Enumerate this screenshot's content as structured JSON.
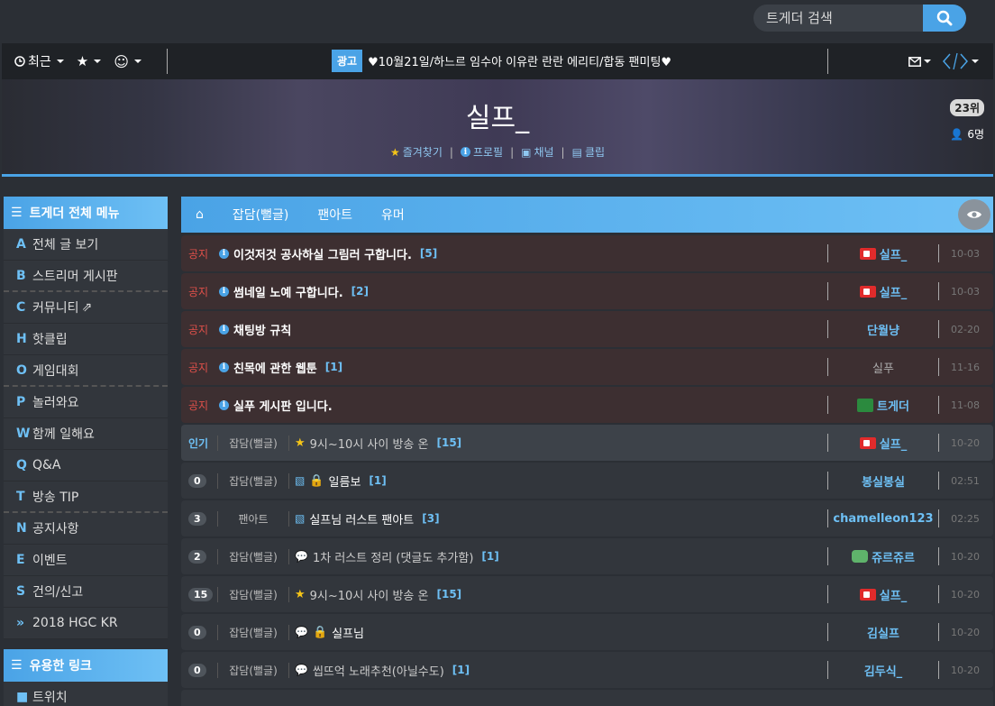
{
  "search": {
    "placeholder": "트게더 검색"
  },
  "nav": {
    "recent": "최근",
    "ad_tag": "광고",
    "ad_text": "♥10월21일/하느르 임수아 이유란 란란 에리티/합동 팬미팅♥"
  },
  "banner": {
    "title": "실프_",
    "links": [
      "즐겨찾기",
      "프로필",
      "채널",
      "클립"
    ],
    "rank": "23위",
    "viewers": "6명"
  },
  "sidebar": {
    "header": "트게더 전체 메뉴",
    "items": [
      {
        "key": "A",
        "label": "전체 글 보기"
      },
      {
        "key": "B",
        "label": "스트리머 게시판"
      },
      {
        "key": "C",
        "label": "커뮤니티"
      },
      {
        "key": "H",
        "label": "핫클립"
      },
      {
        "key": "O",
        "label": "게임대회"
      },
      {
        "key": "P",
        "label": "놀러와요"
      },
      {
        "key": "W",
        "label": "함께 일해요"
      },
      {
        "key": "Q",
        "label": "Q&A"
      },
      {
        "key": "T",
        "label": "방송 TIP"
      },
      {
        "key": "N",
        "label": "공지사항"
      },
      {
        "key": "E",
        "label": "이벤트"
      },
      {
        "key": "S",
        "label": "건의/신고"
      },
      {
        "key": "»",
        "label": "2018 HGC KR"
      }
    ],
    "header2": "유용한 링크",
    "links": [
      {
        "label": "트위치"
      }
    ]
  },
  "tabs": [
    "잡담(뻘글)",
    "팬아트",
    "유머"
  ],
  "posts": [
    {
      "lead": "공지",
      "title": "이것저것 공사하실 그림러 구합니다.",
      "count": "[5]",
      "author": "실프_",
      "date": "10-03"
    },
    {
      "lead": "공지",
      "title": "썸네일 노예 구합니다.",
      "count": "[2]",
      "author": "실프_",
      "date": "10-03"
    },
    {
      "lead": "공지",
      "title": "채팅방 규칙",
      "count": "",
      "author": "단월냥",
      "date": "02-20"
    },
    {
      "lead": "공지",
      "title": "친목에 관한 웹툰",
      "count": "[1]",
      "author": "실푸",
      "date": "11-16"
    },
    {
      "lead": "공지",
      "title": "실푸 게시판 입니다.",
      "count": "",
      "author": "트게더",
      "date": "11-08"
    },
    {
      "lead": "인기",
      "cat": "잡담(뻘글)",
      "title": "9시~10시 사이 방송 온",
      "count": "[15]",
      "author": "실프_",
      "date": "10-20"
    },
    {
      "lead": "0",
      "cat": "잡담(뻘글)",
      "title": "일름보",
      "count": "[1]",
      "author": "봉실봉실",
      "date": "02:51"
    },
    {
      "lead": "3",
      "cat": "팬아트",
      "title": "실프님 러스트 팬아트",
      "count": "[3]",
      "author": "chamelleon123",
      "date": "02:25"
    },
    {
      "lead": "2",
      "cat": "잡담(뻘글)",
      "title": "1차 러스트 정리 (댓글도 추가함)",
      "count": "[1]",
      "author": "쥬르쥬르",
      "date": "10-20"
    },
    {
      "lead": "15",
      "cat": "잡담(뻘글)",
      "title": "9시~10시 사이 방송 온",
      "count": "[15]",
      "author": "실프_",
      "date": "10-20"
    },
    {
      "lead": "0",
      "cat": "잡담(뻘글)",
      "title": "실프님",
      "count": "",
      "author": "김실프",
      "date": "10-20"
    },
    {
      "lead": "0",
      "cat": "잡담(뻘글)",
      "title": "씹뜨억 노래추천(아닐수도)",
      "count": "[1]",
      "author": "김두식_",
      "date": "10-20"
    }
  ]
}
